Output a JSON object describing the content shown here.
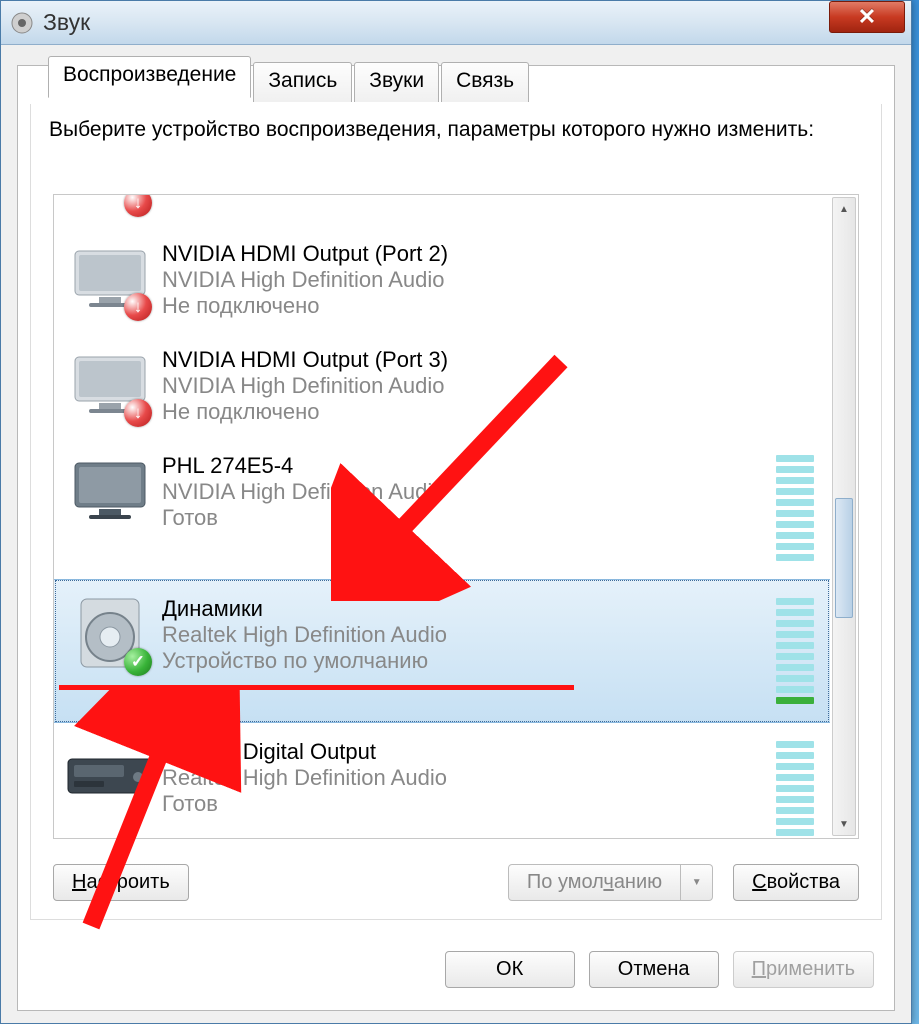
{
  "window": {
    "title": "Звук",
    "close_glyph": "✕"
  },
  "tabs": [
    {
      "label": "Воспроизведение",
      "active": true
    },
    {
      "label": "Запись",
      "active": false
    },
    {
      "label": "Звуки",
      "active": false
    },
    {
      "label": "Связь",
      "active": false
    }
  ],
  "instruction": "Выберите устройство воспроизведения, параметры которого нужно изменить:",
  "devices": [
    {
      "name": "NVIDIA HDMI Output (Port 2)",
      "driver": "NVIDIA High Definition Audio",
      "status": "Не подключено",
      "icon": "monitor",
      "badge": "unplugged",
      "meter": null,
      "selected": false
    },
    {
      "name": "NVIDIA HDMI Output (Port 3)",
      "driver": "NVIDIA High Definition Audio",
      "status": "Не подключено",
      "icon": "monitor",
      "badge": "unplugged",
      "meter": null,
      "selected": false
    },
    {
      "name": "PHL 274E5-4",
      "driver": "NVIDIA High Definition Audio",
      "status": "Готов",
      "icon": "monitor",
      "badge": null,
      "meter": {
        "bars": 10,
        "filled": 0
      },
      "selected": false
    },
    {
      "name": "Динамики",
      "driver": "Realtek High Definition Audio",
      "status": "Устройство по умолчанию",
      "icon": "speaker",
      "badge": "default",
      "meter": {
        "bars": 10,
        "filled": 1
      },
      "selected": true
    },
    {
      "name": "Realtek Digital Output",
      "driver": "Realtek High Definition Audio",
      "status": "Готов",
      "icon": "digital",
      "badge": null,
      "meter": {
        "bars": 10,
        "filled": 0
      },
      "selected": false
    }
  ],
  "buttons": {
    "configure": "Настроить",
    "configure_ul": "Н",
    "default_dropdown": "По умолчанию",
    "default_ul": "ч",
    "properties": "Свойства",
    "properties_ul": "С",
    "ok": "ОК",
    "cancel": "Отмена",
    "apply": "Применить",
    "apply_ul": "П"
  }
}
